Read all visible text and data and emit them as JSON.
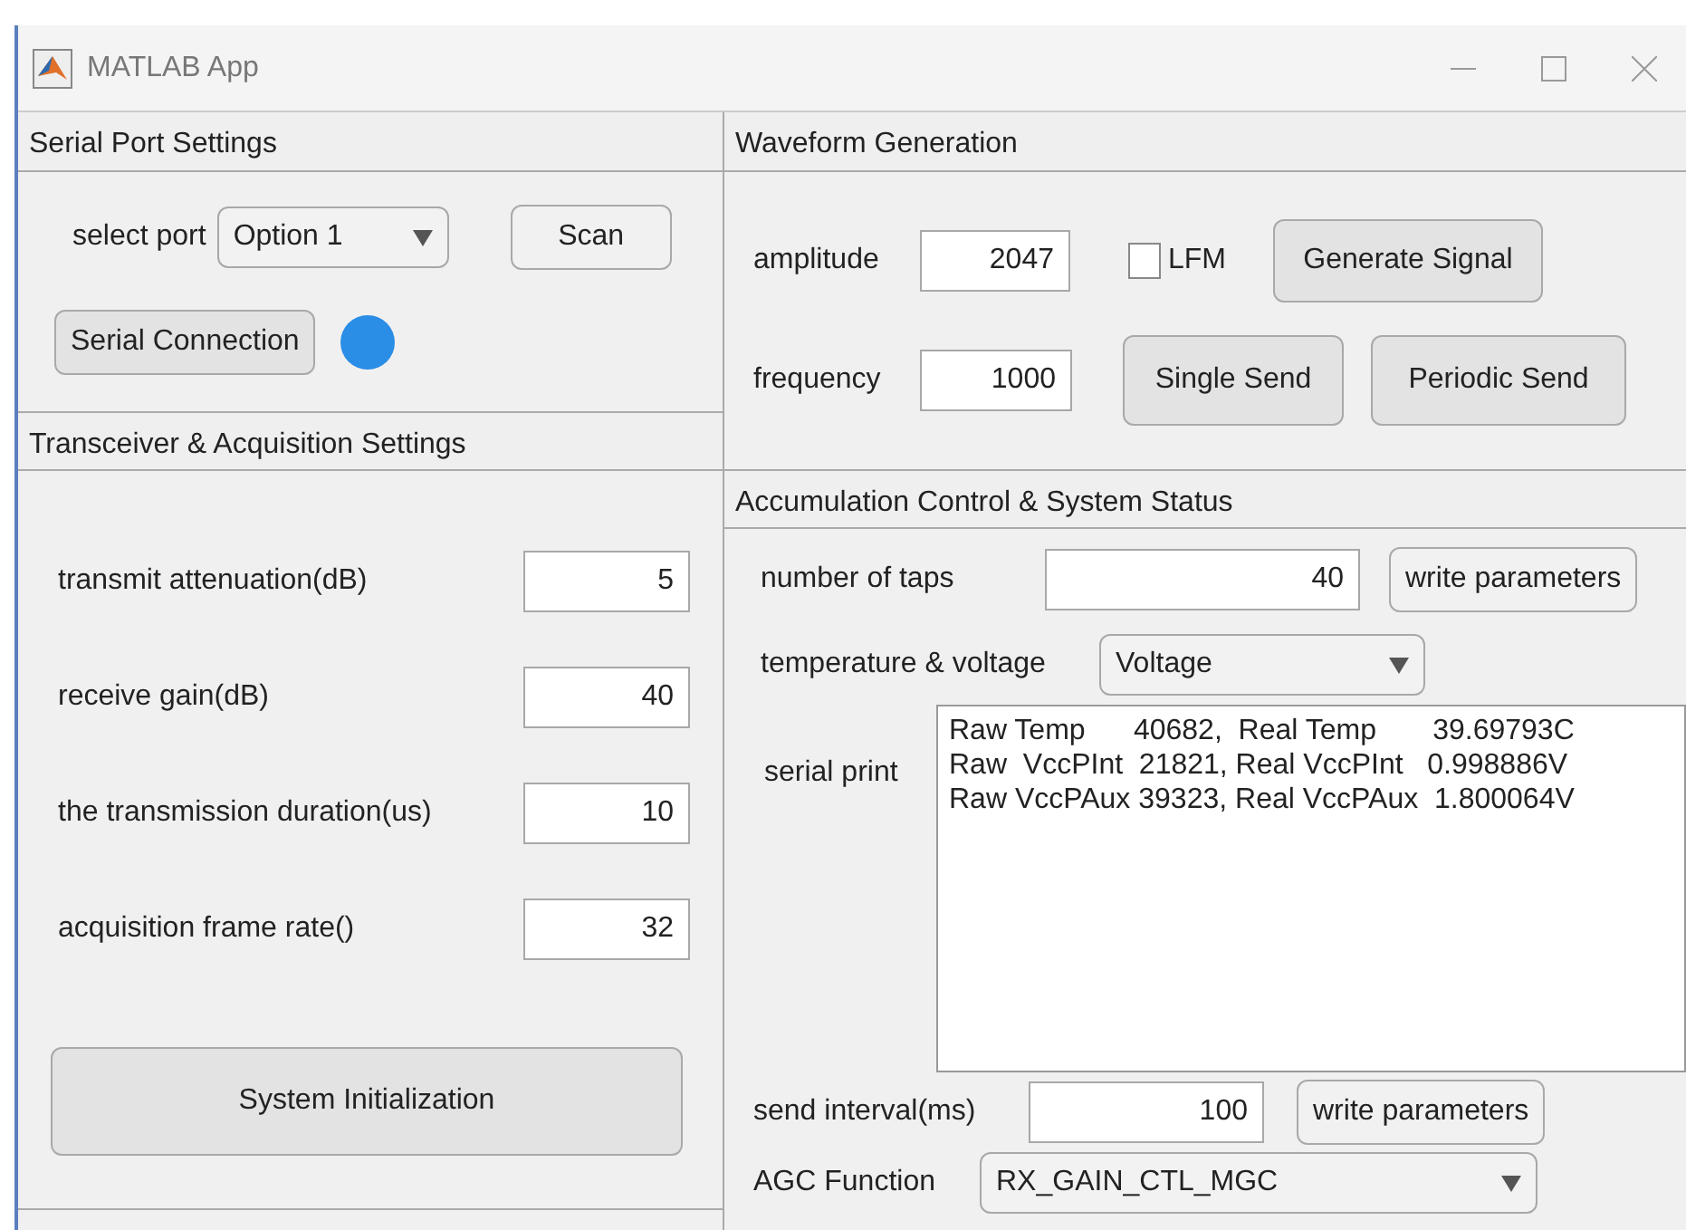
{
  "window": {
    "title": "MATLAB App"
  },
  "serial_port": {
    "title": "Serial Port Settings",
    "port_label": "select  port",
    "port_value": "Option 1",
    "scan_button": "Scan",
    "connect_button": "Serial Connection",
    "status_lamp": {
      "color": "#2a8de6"
    }
  },
  "transceiver": {
    "title": "Transceiver & Acquisition Settings",
    "fields": [
      {
        "label": "transmit attenuation(dB)",
        "value": "5"
      },
      {
        "label": "receive gain(dB)",
        "value": "40"
      },
      {
        "label": "the transmission duration(us)",
        "value": "10"
      },
      {
        "label": "acquisition frame rate()",
        "value": "32"
      }
    ],
    "init_button": "System Initialization"
  },
  "waveform": {
    "title": "Waveform Generation",
    "amplitude_label": "amplitude",
    "amplitude_value": "2047",
    "lfm": {
      "label": "LFM",
      "checked": false
    },
    "generate_button": "Generate Signal",
    "frequency_label": "frequency",
    "frequency_value": "1000",
    "single_button": "Single Send",
    "periodic_button": "Periodic Send"
  },
  "accumulation": {
    "title": "Accumulation Control & System Status",
    "taps_label": "number of taps",
    "taps_value": "40",
    "taps_button": "write parameters",
    "sensor_label": "temperature & voltage",
    "sensor_value": "Voltage",
    "print_label": "serial print",
    "print_lines": [
      "Raw Temp      40682,  Real Temp       39.69793C",
      "Raw  VccPInt  21821, Real VccPInt   0.998886V",
      "Raw VccPAux 39323, Real VccPAux  1.800064V"
    ],
    "interval_label": "send interval(ms)",
    "interval_value": "100",
    "interval_button": "write parameters",
    "agc_label": "AGC Function",
    "agc_value": "RX_GAIN_CTL_MGC"
  }
}
